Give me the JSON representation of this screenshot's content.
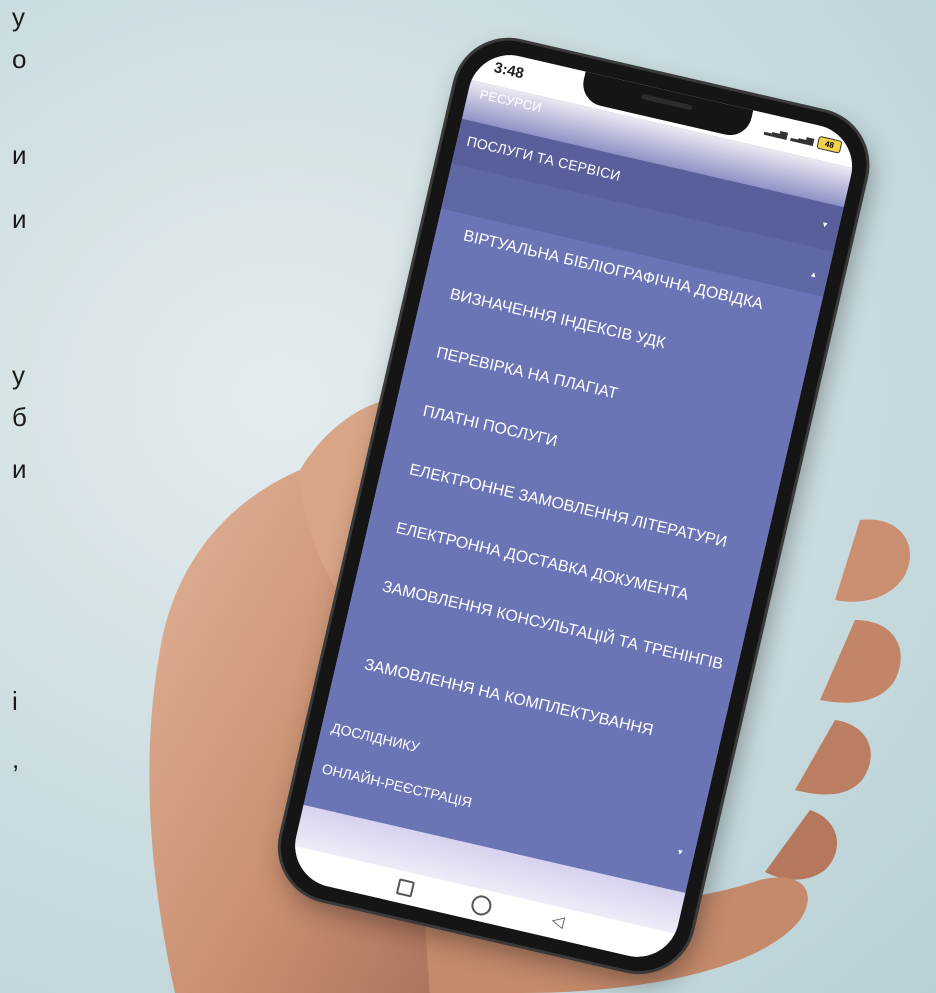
{
  "background_letters": [
    "у",
    "о",
    "и",
    "и",
    "у",
    "б",
    "и",
    "і",
    ","
  ],
  "status_bar": {
    "time": "3:48",
    "battery": "48"
  },
  "menu": {
    "top_item": "РЕСУРСИ",
    "section": {
      "label": "ПОСЛУГИ ТА СЕРВІСИ",
      "caret": "▾"
    },
    "expanded_caret": "▴",
    "sub_items": [
      "ВІРТУАЛЬНА БІБЛІОГРАФІЧНА ДОВІДКА",
      "ВИЗНАЧЕННЯ ІНДЕКСІВ УДК",
      "ПЕРЕВІРКА НА ПЛАГІАТ",
      "ПЛАТНІ ПОСЛУГИ",
      "ЕЛЕКТРОННЕ ЗАМОВЛЕННЯ ЛІТЕРАТУРИ",
      "ЕЛЕКТРОННА ДОСТАВКА ДОКУМЕНТА",
      "ЗАМОВЛЕННЯ КОНСУЛЬТАЦІЙ ТА ТРЕНІНГІВ",
      "ЗАМОВЛЕННЯ НА КОМПЛЕКТУВАННЯ"
    ],
    "lower_items": [
      {
        "label": "ДОСЛІДНИКУ"
      },
      {
        "label": "ОНЛАЙН-РЕЄСТРАЦІЯ",
        "caret": "▾"
      }
    ]
  },
  "colors": {
    "menu_background": "#6b75b6",
    "section_background": "#595f9a",
    "background": "#cfdfe2",
    "battery": "#f1d24a"
  }
}
